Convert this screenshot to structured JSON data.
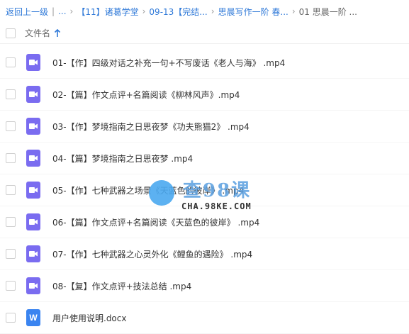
{
  "breadcrumb": {
    "back": "返回上一级",
    "ellipsis": "...",
    "items": [
      "【11】诸葛学堂",
      "09-13【完结...",
      "思晨写作一阶 春..."
    ],
    "current": "01 思晨一阶 ..."
  },
  "header": {
    "column_title": "文件名"
  },
  "files": [
    {
      "name": "01-【作】四级对话之补充一句+不写废话《老人与海》 .mp4",
      "icon": "video-icon"
    },
    {
      "name": "02-【篇】作文点评+名篇阅读《柳林风声》.mp4",
      "icon": "video-icon"
    },
    {
      "name": "03-【作】梦境指南之日思夜梦《功夫熊猫2》 .mp4",
      "icon": "video-icon"
    },
    {
      "name": "04-【篇】梦境指南之日思夜梦 .mp4",
      "icon": "video-icon"
    },
    {
      "name": "05-【作】七种武器之场景《天蓝色的彼岸》 .mp4",
      "icon": "video-icon"
    },
    {
      "name": "06-【篇】作文点评+名篇阅读《天蓝色的彼岸》 .mp4",
      "icon": "video-icon"
    },
    {
      "name": "07-【作】七种武器之心灵外化《鲤鱼的遇险》 .mp4",
      "icon": "video-icon"
    },
    {
      "name": "08-【复】作文点评+技法总结 .mp4",
      "icon": "video-icon"
    },
    {
      "name": "用户使用说明.docx",
      "icon": "word-doc-icon",
      "glyph": "W"
    }
  ],
  "watermark": {
    "title": "查98课",
    "url": "CHA.98KE.COM"
  },
  "colors": {
    "link": "#2f79d8",
    "video_icon": "#7a6cf0",
    "doc_icon": "#3a84f0"
  }
}
